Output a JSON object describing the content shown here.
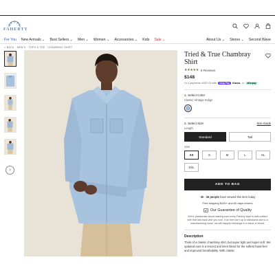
{
  "brand": {
    "name": "FAHERTY"
  },
  "header": {
    "icons": [
      "search-icon",
      "heart-icon",
      "account-icon",
      "bag-icon"
    ]
  },
  "nav": {
    "left": [
      {
        "label": "For You",
        "state": "active"
      },
      {
        "label": "New Arrivals ⌄",
        "state": ""
      },
      {
        "label": "Best Sellers ⌄",
        "state": ""
      },
      {
        "label": "Men ⌄",
        "state": ""
      },
      {
        "label": "Women ⌄",
        "state": ""
      },
      {
        "label": "Accessories ⌄",
        "state": ""
      },
      {
        "label": "Kids",
        "state": ""
      },
      {
        "label": "Sale ⌄",
        "state": "sale"
      }
    ],
    "right": [
      {
        "label": "About Us ⌄"
      },
      {
        "label": "Stores ⌄"
      },
      {
        "label": "Second Wave"
      }
    ]
  },
  "breadcrumb": "< BACK · MEN'S · TOPS & TEE · CHAMBRAY SHIRT",
  "gallery": {
    "next_label": "›",
    "thumbnail_count": 5
  },
  "product": {
    "title": "Tried & True Chambray Shirt",
    "rating_stars": "★★★★★",
    "rating": 4.5,
    "reviews": "5 Reviews",
    "price": "$148",
    "installments_text": "Or 4 payments of $37.00 with",
    "shop_pay": "shop Pay",
    "klarna": "Klarna.",
    "or": "or",
    "afterpay": "afterpay",
    "color_label": "1. Select Color",
    "color_name": "Classic Vintage Indigo",
    "swatch_color": "#a7b9cf",
    "size_label": "2. Select Size",
    "size_guide": "Size Guide",
    "length_label": "Length",
    "lengths": [
      {
        "label": "Standard",
        "selected": true
      },
      {
        "label": "Tall",
        "selected": false
      }
    ],
    "size_heading": "Size",
    "sizes": [
      {
        "label": "XS",
        "selected": true
      },
      {
        "label": "S",
        "selected": false
      },
      {
        "label": "M",
        "selected": false
      },
      {
        "label": "L",
        "selected": false
      },
      {
        "label": "XL",
        "selected": false
      },
      {
        "label": "XXL",
        "selected": false
      }
    ],
    "add_to_bag": "ADD TO BAG",
    "viewers_count": "36 people",
    "viewers_text": " have viewed this item today",
    "shipping": "Free shipping $100+ and 60 days returns",
    "guarantee_title": "Our Guarantee of Quality",
    "guarantee_text": "We're passionate about making sure every Faherty style is well-crafted with that laid back vibe you love. If an item isn't up to standards due to a manufacturing issue, we will happily exchange it or issue a refund.",
    "description_heading": "Description",
    "description_text": "Think of a classic chambray shirt, but super light and super soft. We updated ours in a lenced and linen blend for the softest hand-feel and improved breathability. With classic"
  },
  "colors": {
    "accent_blue": "#2b55c8",
    "sale_red": "#d23333",
    "button_dark": "#222222",
    "rating_star": "#7a6b4c"
  }
}
